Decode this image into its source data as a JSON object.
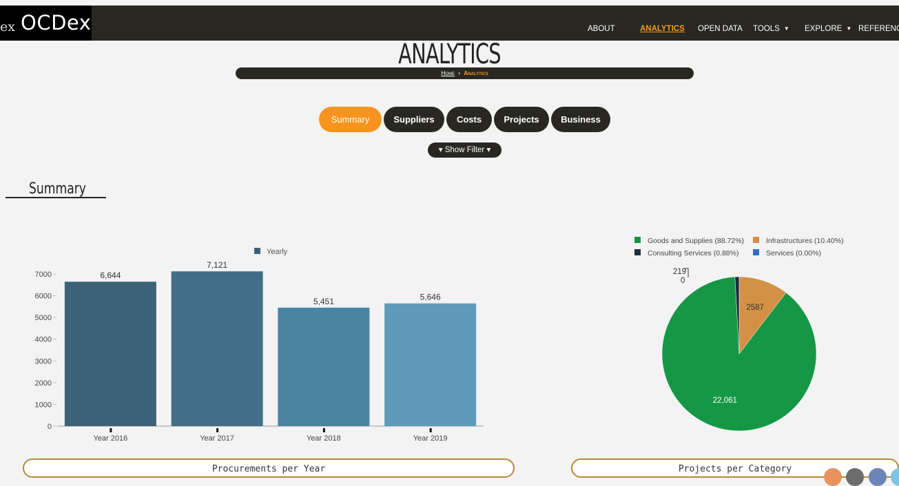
{
  "nav": {
    "logo_prefix": "ex",
    "logo_name": "OCDex",
    "items": [
      {
        "label": "ABOUT",
        "active": false,
        "dropdown": false
      },
      {
        "label": "ANALYTICS",
        "active": true,
        "dropdown": false
      },
      {
        "label": "OPEN DATA",
        "active": false,
        "dropdown": false
      },
      {
        "label": "TOOLS",
        "active": false,
        "dropdown": true
      },
      {
        "label": "EXPLORE",
        "active": false,
        "dropdown": true
      },
      {
        "label": "REFERENCE",
        "active": false,
        "dropdown": false
      }
    ]
  },
  "page": {
    "title": "ANALYTICS",
    "breadcrumb": {
      "home": "Home",
      "current": "Analytics"
    }
  },
  "tabs": [
    {
      "label": "Summary",
      "active": true
    },
    {
      "label": "Suppliers",
      "active": false
    },
    {
      "label": "Costs",
      "active": false
    },
    {
      "label": "Projects",
      "active": false
    },
    {
      "label": "Business",
      "active": false
    }
  ],
  "filter": {
    "label": "▾ Show Filter ▾"
  },
  "section": {
    "title": "Summary"
  },
  "charts": {
    "bar_caption": "Procurements per Year",
    "pie_caption": "Projects per Category"
  },
  "colors": {
    "accent": "#f7941d",
    "dark": "#282722",
    "bars": [
      "#3c6278",
      "#426e89",
      "#4b84a3",
      "#5f9aba"
    ],
    "pie": [
      "#169745",
      "#d29145",
      "#1c2e3b",
      "#3370c4"
    ]
  },
  "chart_data": [
    {
      "type": "bar",
      "categories": [
        "Year 2016",
        "Year 2017",
        "Year 2018",
        "Year 2019"
      ],
      "series": [
        {
          "name": "Yearly",
          "values": [
            6644,
            7121,
            5451,
            5646
          ]
        }
      ],
      "value_labels": [
        "6,644",
        "7,121",
        "5,451",
        "5,646"
      ],
      "yticks": [
        0,
        1000,
        2000,
        3000,
        4000,
        5000,
        6000,
        7000
      ],
      "ylim": [
        0,
        7000
      ],
      "legend": "top",
      "grid": false
    },
    {
      "type": "pie",
      "legend_entries": [
        "Goods and Supplies (88.72%)",
        "Infrastructures (10.40%)",
        "Consulting Services (0.88%)",
        "Services (0.00%)"
      ],
      "values": [
        22061,
        2587,
        219,
        0
      ],
      "value_labels": [
        "22,061",
        "2587",
        "219",
        "0"
      ],
      "legend": "top"
    }
  ],
  "social": [
    {
      "name": "rss-icon",
      "color": "#e8935f"
    },
    {
      "name": "email-icon",
      "color": "#6d6d6d"
    },
    {
      "name": "facebook-icon",
      "color": "#6a86b8"
    },
    {
      "name": "twitter-icon",
      "color": "#7fc2e6"
    }
  ]
}
